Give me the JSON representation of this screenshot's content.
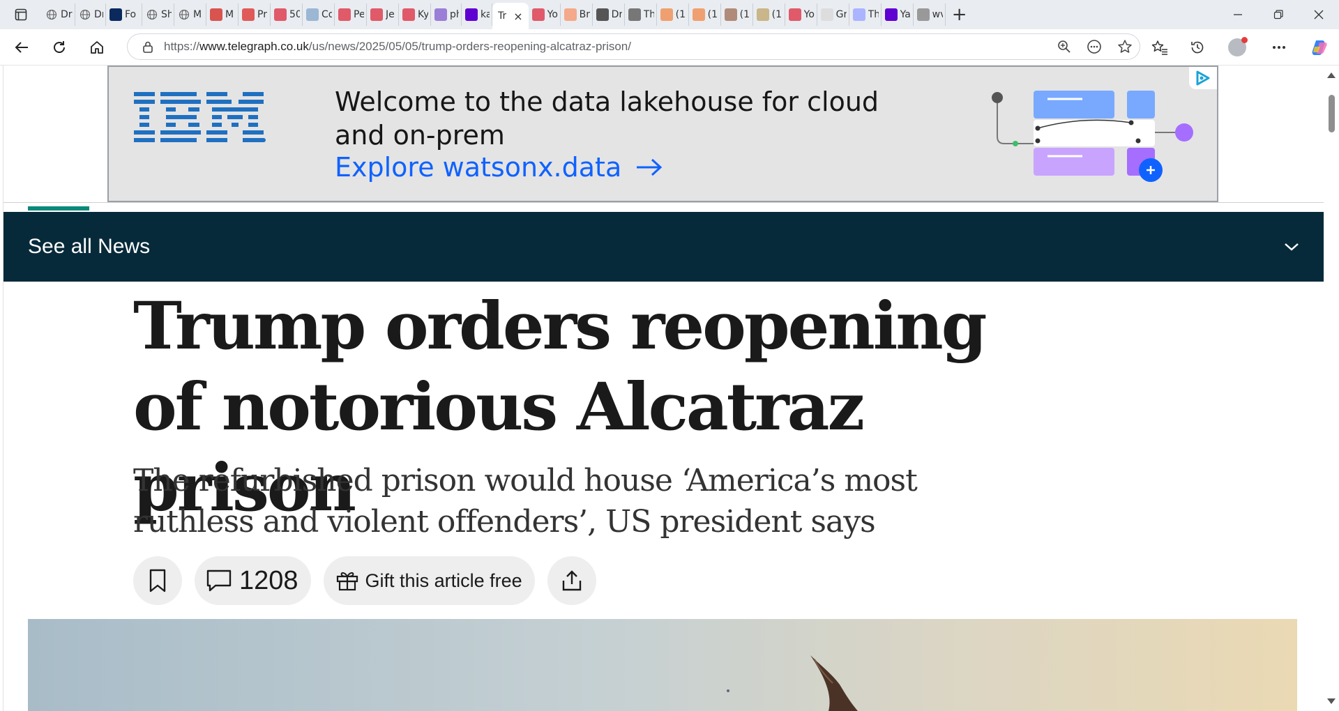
{
  "browser": {
    "tabs": [
      {
        "title": "Dr",
        "icon": "globe-icon",
        "color": "#777777"
      },
      {
        "title": "Dr",
        "icon": "globe-icon",
        "color": "#777777"
      },
      {
        "title": "Fo",
        "icon": "fox-news-icon",
        "color": "#0a2a5e"
      },
      {
        "title": "Sh",
        "icon": "globe-icon",
        "color": "#777777"
      },
      {
        "title": "M",
        "icon": "globe-icon",
        "color": "#777777"
      },
      {
        "title": "M",
        "icon": "r-logo-icon",
        "color": "#d9534f"
      },
      {
        "title": "Pr",
        "icon": "pdf-icon",
        "color": "#e05a5a"
      },
      {
        "title": "50",
        "icon": "youtube-icon",
        "color": "#e05a6a"
      },
      {
        "title": "Co",
        "icon": "feather-icon",
        "color": "#9bb7d4"
      },
      {
        "title": "Pe",
        "icon": "youtube-icon",
        "color": "#e05a6a"
      },
      {
        "title": "Je",
        "icon": "youtube-icon",
        "color": "#e05a6a"
      },
      {
        "title": "Ky",
        "icon": "youtube-icon",
        "color": "#e05a6a"
      },
      {
        "title": "ph",
        "icon": "yahoo-icon",
        "color": "#9b7fd6"
      },
      {
        "title": "ka",
        "icon": "yahoo-icon",
        "color": "#5f01d1"
      },
      {
        "title": "Yo",
        "icon": "youtube-icon",
        "color": "#e05a6a"
      },
      {
        "title": "Br",
        "icon": "blogger-icon",
        "color": "#f4a98a"
      },
      {
        "title": "Dr",
        "icon": "slash-logo-icon",
        "color": "#555555"
      },
      {
        "title": "Th",
        "icon": "diamond-icon",
        "color": "#777777"
      },
      {
        "title": "(1(",
        "icon": "bookmark-orange-icon",
        "color": "#f0a070"
      },
      {
        "title": "(1(",
        "icon": "bookmark-orange-icon",
        "color": "#f0a070"
      },
      {
        "title": "(1(",
        "icon": "photo-icon",
        "color": "#b08b7a"
      },
      {
        "title": "(1(",
        "icon": "photo-icon",
        "color": "#c9b68a"
      },
      {
        "title": "Yo",
        "icon": "youtube-icon",
        "color": "#e05a6a"
      },
      {
        "title": "Gr",
        "icon": "google-icon",
        "color": "#dddddd"
      },
      {
        "title": "Th",
        "icon": "gp-icon",
        "color": "#aab4ff"
      },
      {
        "title": "Ya",
        "icon": "yahoo-icon",
        "color": "#5f01d1"
      },
      {
        "title": "wv",
        "icon": "doc-icon",
        "color": "#999999"
      }
    ],
    "active_tab": {
      "title": "Tr",
      "close": "×"
    },
    "new_tab": "+",
    "url_scheme": "https://",
    "url_host": "www.telegraph.co.uk",
    "url_path": "/us/news/2025/05/05/trump-orders-reopening-alcatraz-prison/"
  },
  "ad": {
    "brand": "IBM",
    "headline": "Welcome to the data lakehouse for cloud and on-prem",
    "cta": "Explore watsonx.data",
    "colors": {
      "blue": "#0f62fe",
      "ibm": "#1f70c1",
      "purple": "#a56eff",
      "bg": "#e4e4e4"
    }
  },
  "nav": {
    "section_label": "See all News",
    "colors": {
      "bar": "#072a3a",
      "accent": "#0a8a7a"
    }
  },
  "article": {
    "headline": "Trump orders reopening of notorious Alcatraz prison",
    "standfirst": "The refurbished prison would house ‘America’s most ruthless and violent offenders’, US president says",
    "comment_count": "1208",
    "gift_label": "Gift this article free"
  }
}
